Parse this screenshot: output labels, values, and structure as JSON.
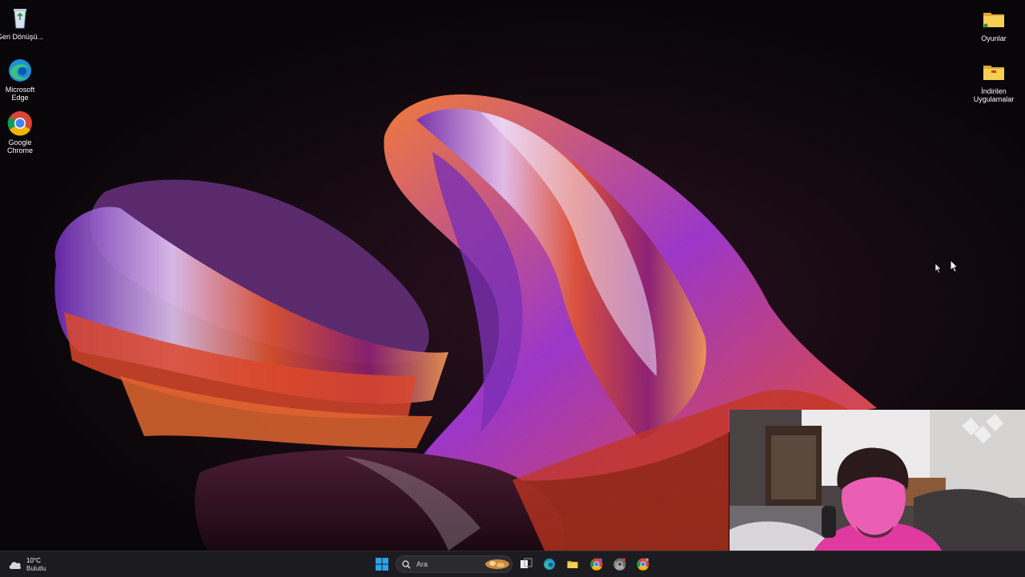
{
  "desktop": {
    "icons_left": [
      {
        "id": "recycle-bin",
        "label": "Geri Dönüşü...",
        "icon": "recycle-bin-icon"
      },
      {
        "id": "microsoft-edge",
        "label": "Microsoft Edge",
        "icon": "edge-icon"
      },
      {
        "id": "google-chrome",
        "label": "Google Chrome",
        "icon": "chrome-icon"
      }
    ],
    "icons_right": [
      {
        "id": "oyunlar",
        "label": "Oyunlar",
        "icon": "folder-icon"
      },
      {
        "id": "indirilen-uygulamalar",
        "label": "İndirilen Uygulamalar",
        "icon": "folder-icon"
      }
    ]
  },
  "taskbar": {
    "weather": {
      "temp": "10°C",
      "condition": "Bulutlu",
      "icon": "cloud-icon"
    },
    "search_placeholder": "Ara",
    "apps": [
      {
        "name": "task-view",
        "icon": "task-view-icon"
      },
      {
        "name": "edge",
        "icon": "edge-icon"
      },
      {
        "name": "file-explorer",
        "icon": "folder-icon"
      },
      {
        "name": "chrome-1",
        "icon": "chrome-icon"
      },
      {
        "name": "chrome-2",
        "icon": "chrome-icon"
      },
      {
        "name": "chrome-3",
        "icon": "chrome-icon"
      }
    ]
  },
  "colors": {
    "taskbar": "#1c1b1f",
    "background": "#080608",
    "folder": "#f2c84b",
    "webcam_light": "#e0399f"
  }
}
